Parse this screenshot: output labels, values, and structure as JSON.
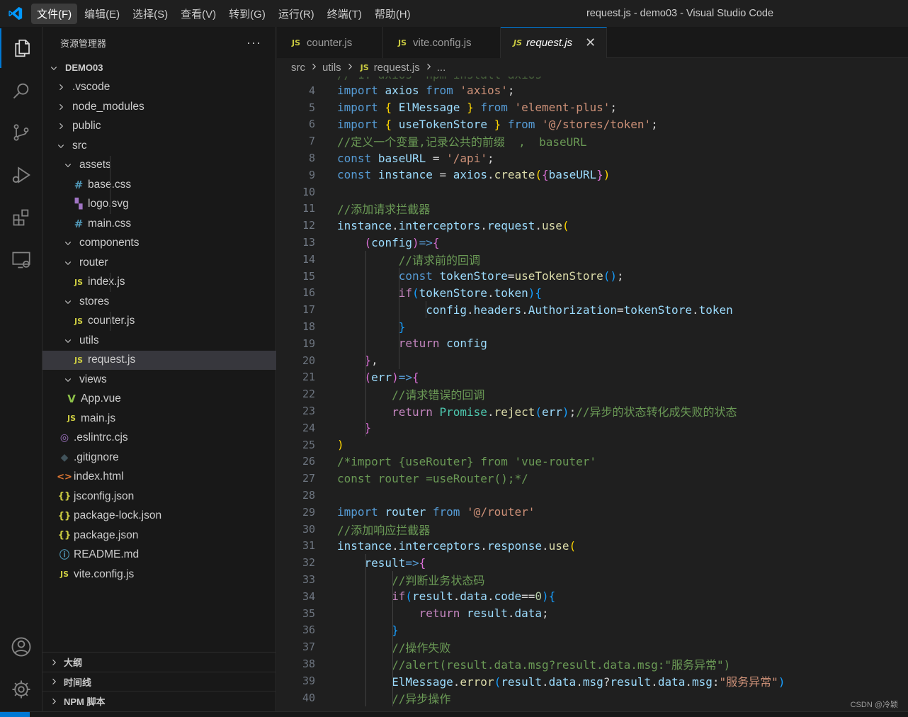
{
  "window_title": "request.js - demo03 - Visual Studio Code",
  "menu": [
    "文件(F)",
    "编辑(E)",
    "选择(S)",
    "查看(V)",
    "转到(G)",
    "运行(R)",
    "终端(T)",
    "帮助(H)"
  ],
  "colors": {
    "accent": "#0078d4",
    "js_icon": "#cbcb41"
  },
  "sidebar": {
    "title": "资源管理器",
    "more": "···",
    "tree": [
      {
        "label": "DEMO03",
        "depth": 0,
        "kind": "root",
        "open": true
      },
      {
        "label": ".vscode",
        "depth": 1,
        "kind": "folder",
        "open": false
      },
      {
        "label": "node_modules",
        "depth": 1,
        "kind": "folder",
        "open": false
      },
      {
        "label": "public",
        "depth": 1,
        "kind": "folder",
        "open": false
      },
      {
        "label": "src",
        "depth": 1,
        "kind": "folder",
        "open": true
      },
      {
        "label": "assets",
        "depth": 2,
        "kind": "folder",
        "open": true
      },
      {
        "label": "base.css",
        "depth": 3,
        "kind": "css"
      },
      {
        "label": "logo.svg",
        "depth": 3,
        "kind": "svg"
      },
      {
        "label": "main.css",
        "depth": 3,
        "kind": "css"
      },
      {
        "label": "components",
        "depth": 2,
        "kind": "folder",
        "open": true
      },
      {
        "label": "router",
        "depth": 2,
        "kind": "folder",
        "open": true
      },
      {
        "label": "index.js",
        "depth": 3,
        "kind": "js"
      },
      {
        "label": "stores",
        "depth": 2,
        "kind": "folder",
        "open": true
      },
      {
        "label": "counter.js",
        "depth": 3,
        "kind": "js"
      },
      {
        "label": "utils",
        "depth": 2,
        "kind": "folder",
        "open": true
      },
      {
        "label": "request.js",
        "depth": 3,
        "kind": "js",
        "selected": true
      },
      {
        "label": "views",
        "depth": 2,
        "kind": "folder",
        "open": true
      },
      {
        "label": "App.vue",
        "depth": 2,
        "kind": "vue"
      },
      {
        "label": "main.js",
        "depth": 2,
        "kind": "js"
      },
      {
        "label": ".eslintrc.cjs",
        "depth": 1,
        "kind": "esl"
      },
      {
        "label": ".gitignore",
        "depth": 1,
        "kind": "git"
      },
      {
        "label": "index.html",
        "depth": 1,
        "kind": "html"
      },
      {
        "label": "jsconfig.json",
        "depth": 1,
        "kind": "json"
      },
      {
        "label": "package-lock.json",
        "depth": 1,
        "kind": "json"
      },
      {
        "label": "package.json",
        "depth": 1,
        "kind": "json"
      },
      {
        "label": "README.md",
        "depth": 1,
        "kind": "md"
      },
      {
        "label": "vite.config.js",
        "depth": 1,
        "kind": "js"
      }
    ],
    "panels": [
      "大纲",
      "时间线",
      "NPM 脚本"
    ]
  },
  "icon_glyphs": {
    "js": "JS",
    "css": "#",
    "json": "{}",
    "html": "<>",
    "md": "ⓘ",
    "vue": "V",
    "git": "◆",
    "esl": "◎",
    "svg": "▚"
  },
  "tabs": [
    {
      "label": "counter.js",
      "icon": "JS",
      "active": false
    },
    {
      "label": "vite.config.js",
      "icon": "JS",
      "active": false
    },
    {
      "label": "request.js",
      "icon": "JS",
      "active": true
    }
  ],
  "tab_close": "✕",
  "breadcrumb": {
    "parts": [
      "src",
      "utils",
      "request.js",
      "..."
    ],
    "file_icon": "JS"
  },
  "editor": {
    "lines": [
      {
        "n": "4",
        "tokens": [
          [
            "k",
            "import"
          ],
          [
            "p",
            " "
          ],
          [
            "v",
            "axios"
          ],
          [
            "p",
            " "
          ],
          [
            "k",
            "from"
          ],
          [
            "p",
            " "
          ],
          [
            "s",
            "'axios'"
          ],
          [
            "p",
            ";"
          ]
        ]
      },
      {
        "n": "5",
        "tokens": [
          [
            "k",
            "import"
          ],
          [
            "p",
            " "
          ],
          [
            "b1",
            "{"
          ],
          [
            "p",
            " "
          ],
          [
            "v",
            "ElMessage"
          ],
          [
            "p",
            " "
          ],
          [
            "b1",
            "}"
          ],
          [
            "p",
            " "
          ],
          [
            "k",
            "from"
          ],
          [
            "p",
            " "
          ],
          [
            "s",
            "'element-plus'"
          ],
          [
            "p",
            ";"
          ]
        ]
      },
      {
        "n": "6",
        "tokens": [
          [
            "k",
            "import"
          ],
          [
            "p",
            " "
          ],
          [
            "b1",
            "{"
          ],
          [
            "p",
            " "
          ],
          [
            "v",
            "useTokenStore"
          ],
          [
            "p",
            " "
          ],
          [
            "b1",
            "}"
          ],
          [
            "p",
            " "
          ],
          [
            "k",
            "from"
          ],
          [
            "p",
            " "
          ],
          [
            "s",
            "'@/stores/token'"
          ],
          [
            "p",
            ";"
          ]
        ]
      },
      {
        "n": "7",
        "tokens": [
          [
            "c",
            "//定义一个变量,记录公共的前缀  ,  baseURL"
          ]
        ]
      },
      {
        "n": "8",
        "tokens": [
          [
            "k",
            "const"
          ],
          [
            "p",
            " "
          ],
          [
            "v",
            "baseURL"
          ],
          [
            "p",
            " = "
          ],
          [
            "s",
            "'/api'"
          ],
          [
            "p",
            ";"
          ]
        ]
      },
      {
        "n": "9",
        "tokens": [
          [
            "k",
            "const"
          ],
          [
            "p",
            " "
          ],
          [
            "v",
            "instance"
          ],
          [
            "p",
            " = "
          ],
          [
            "v",
            "axios"
          ],
          [
            "p",
            "."
          ],
          [
            "f",
            "create"
          ],
          [
            "b1",
            "("
          ],
          [
            "b2",
            "{"
          ],
          [
            "v",
            "baseURL"
          ],
          [
            "b2",
            "}"
          ],
          [
            "b1",
            ")"
          ]
        ]
      },
      {
        "n": "10",
        "tokens": []
      },
      {
        "n": "11",
        "tokens": [
          [
            "c",
            "//添加请求拦截器"
          ]
        ]
      },
      {
        "n": "12",
        "tokens": [
          [
            "v",
            "instance"
          ],
          [
            "p",
            "."
          ],
          [
            "v",
            "interceptors"
          ],
          [
            "p",
            "."
          ],
          [
            "v",
            "request"
          ],
          [
            "p",
            "."
          ],
          [
            "f",
            "use"
          ],
          [
            "b1",
            "("
          ]
        ]
      },
      {
        "n": "13",
        "tokens": [
          [
            "p",
            "    "
          ],
          [
            "b2",
            "("
          ],
          [
            "v",
            "config"
          ],
          [
            "b2",
            ")"
          ],
          [
            "k",
            "=>"
          ],
          [
            "b2",
            "{"
          ]
        ]
      },
      {
        "n": "14",
        "tokens": [
          [
            "p",
            "         "
          ],
          [
            "c",
            "//请求前的回调"
          ]
        ]
      },
      {
        "n": "15",
        "tokens": [
          [
            "p",
            "         "
          ],
          [
            "k",
            "const"
          ],
          [
            "p",
            " "
          ],
          [
            "v",
            "tokenStore"
          ],
          [
            "p",
            "="
          ],
          [
            "f",
            "useTokenStore"
          ],
          [
            "b3",
            "()"
          ],
          [
            "p",
            ";"
          ]
        ]
      },
      {
        "n": "16",
        "tokens": [
          [
            "p",
            "         "
          ],
          [
            "kc",
            "if"
          ],
          [
            "b3",
            "("
          ],
          [
            "v",
            "tokenStore"
          ],
          [
            "p",
            "."
          ],
          [
            "v",
            "token"
          ],
          [
            "b3",
            ")"
          ],
          [
            "b3",
            "{"
          ]
        ]
      },
      {
        "n": "17",
        "tokens": [
          [
            "p",
            "             "
          ],
          [
            "v",
            "config"
          ],
          [
            "p",
            "."
          ],
          [
            "v",
            "headers"
          ],
          [
            "p",
            "."
          ],
          [
            "v",
            "Authorization"
          ],
          [
            "p",
            "="
          ],
          [
            "v",
            "tokenStore"
          ],
          [
            "p",
            "."
          ],
          [
            "v",
            "token"
          ]
        ]
      },
      {
        "n": "18",
        "tokens": [
          [
            "p",
            "         "
          ],
          [
            "b3",
            "}"
          ]
        ]
      },
      {
        "n": "19",
        "tokens": [
          [
            "p",
            "         "
          ],
          [
            "kc",
            "return"
          ],
          [
            "p",
            " "
          ],
          [
            "v",
            "config"
          ]
        ]
      },
      {
        "n": "20",
        "tokens": [
          [
            "p",
            "    "
          ],
          [
            "b2",
            "}"
          ],
          [
            "p",
            ","
          ]
        ]
      },
      {
        "n": "21",
        "tokens": [
          [
            "p",
            "    "
          ],
          [
            "b2",
            "("
          ],
          [
            "v",
            "err"
          ],
          [
            "b2",
            ")"
          ],
          [
            "k",
            "=>"
          ],
          [
            "b2",
            "{"
          ]
        ]
      },
      {
        "n": "22",
        "tokens": [
          [
            "p",
            "        "
          ],
          [
            "c",
            "//请求错误的回调"
          ]
        ]
      },
      {
        "n": "23",
        "tokens": [
          [
            "p",
            "        "
          ],
          [
            "kc",
            "return"
          ],
          [
            "p",
            " "
          ],
          [
            "t",
            "Promise"
          ],
          [
            "p",
            "."
          ],
          [
            "f",
            "reject"
          ],
          [
            "b3",
            "("
          ],
          [
            "v",
            "err"
          ],
          [
            "b3",
            ")"
          ],
          [
            "p",
            ";"
          ],
          [
            "c",
            "//异步的状态转化成失败的状态"
          ]
        ]
      },
      {
        "n": "24",
        "tokens": [
          [
            "p",
            "    "
          ],
          [
            "b2",
            "}"
          ]
        ]
      },
      {
        "n": "25",
        "tokens": [
          [
            "b1",
            ")"
          ]
        ]
      },
      {
        "n": "26",
        "tokens": [
          [
            "c",
            "/*import {useRouter} from 'vue-router'"
          ]
        ]
      },
      {
        "n": "27",
        "tokens": [
          [
            "c",
            "const router =useRouter();*/"
          ]
        ]
      },
      {
        "n": "28",
        "tokens": []
      },
      {
        "n": "29",
        "tokens": [
          [
            "k",
            "import"
          ],
          [
            "p",
            " "
          ],
          [
            "v",
            "router"
          ],
          [
            "p",
            " "
          ],
          [
            "k",
            "from"
          ],
          [
            "p",
            " "
          ],
          [
            "s",
            "'@/router'"
          ]
        ]
      },
      {
        "n": "30",
        "tokens": [
          [
            "c",
            "//添加响应拦截器"
          ]
        ]
      },
      {
        "n": "31",
        "tokens": [
          [
            "v",
            "instance"
          ],
          [
            "p",
            "."
          ],
          [
            "v",
            "interceptors"
          ],
          [
            "p",
            "."
          ],
          [
            "v",
            "response"
          ],
          [
            "p",
            "."
          ],
          [
            "f",
            "use"
          ],
          [
            "b1",
            "("
          ]
        ]
      },
      {
        "n": "32",
        "tokens": [
          [
            "p",
            "    "
          ],
          [
            "v",
            "result"
          ],
          [
            "k",
            "=>"
          ],
          [
            "b2",
            "{"
          ]
        ]
      },
      {
        "n": "33",
        "tokens": [
          [
            "p",
            "        "
          ],
          [
            "c",
            "//判断业务状态码"
          ]
        ]
      },
      {
        "n": "34",
        "tokens": [
          [
            "p",
            "        "
          ],
          [
            "kc",
            "if"
          ],
          [
            "b3",
            "("
          ],
          [
            "v",
            "result"
          ],
          [
            "p",
            "."
          ],
          [
            "v",
            "data"
          ],
          [
            "p",
            "."
          ],
          [
            "v",
            "code"
          ],
          [
            "p",
            "=="
          ],
          [
            "n",
            "0"
          ],
          [
            "b3",
            ")"
          ],
          [
            "b3",
            "{"
          ]
        ]
      },
      {
        "n": "35",
        "tokens": [
          [
            "p",
            "            "
          ],
          [
            "kc",
            "return"
          ],
          [
            "p",
            " "
          ],
          [
            "v",
            "result"
          ],
          [
            "p",
            "."
          ],
          [
            "v",
            "data"
          ],
          [
            "p",
            ";"
          ]
        ]
      },
      {
        "n": "36",
        "tokens": [
          [
            "p",
            "        "
          ],
          [
            "b3",
            "}"
          ]
        ]
      },
      {
        "n": "37",
        "tokens": [
          [
            "p",
            "        "
          ],
          [
            "c",
            "//操作失败"
          ]
        ]
      },
      {
        "n": "38",
        "tokens": [
          [
            "p",
            "        "
          ],
          [
            "c",
            "//alert(result.data.msg?result.data.msg:\"服务异常\")"
          ]
        ]
      },
      {
        "n": "39",
        "tokens": [
          [
            "p",
            "        "
          ],
          [
            "v",
            "ElMessage"
          ],
          [
            "p",
            "."
          ],
          [
            "f",
            "error"
          ],
          [
            "b3",
            "("
          ],
          [
            "v",
            "result"
          ],
          [
            "p",
            "."
          ],
          [
            "v",
            "data"
          ],
          [
            "p",
            "."
          ],
          [
            "v",
            "msg"
          ],
          [
            "p",
            "?"
          ],
          [
            "v",
            "result"
          ],
          [
            "p",
            "."
          ],
          [
            "v",
            "data"
          ],
          [
            "p",
            "."
          ],
          [
            "v",
            "msg"
          ],
          [
            "p",
            ":"
          ],
          [
            "s",
            "\"服务异常\""
          ],
          [
            "b3",
            ")"
          ]
        ]
      },
      {
        "n": "40",
        "tokens": [
          [
            "p",
            "        "
          ],
          [
            "c",
            "//异步操作"
          ]
        ]
      }
    ]
  },
  "watermark": "CSDN @冷颖"
}
